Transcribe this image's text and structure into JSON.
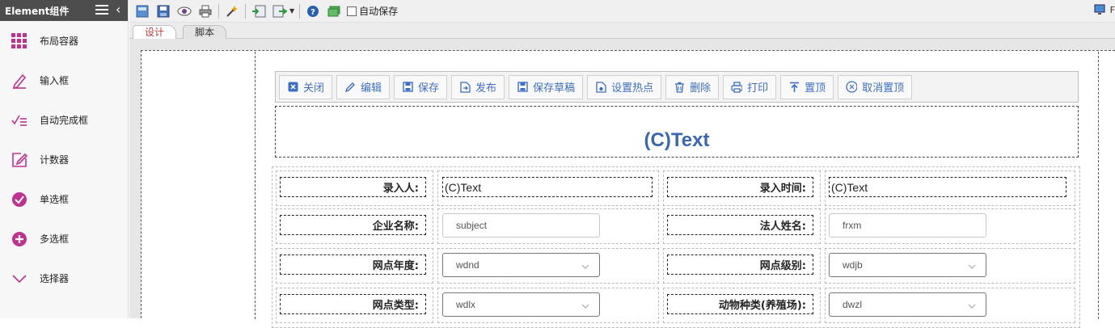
{
  "sidebar": {
    "title": "Element组件",
    "items": [
      {
        "label": "布局容器",
        "icon": "grid-icon"
      },
      {
        "label": "输入框",
        "icon": "pen-input-icon"
      },
      {
        "label": "自动完成框",
        "icon": "autocomplete-icon"
      },
      {
        "label": "计数器",
        "icon": "edit-box-icon"
      },
      {
        "label": "单选框",
        "icon": "check-circle-icon"
      },
      {
        "label": "多选框",
        "icon": "plus-circle-icon"
      },
      {
        "label": "选择器",
        "icon": "chevron-down-icon"
      }
    ]
  },
  "toolbar": {
    "buttons": [
      "new-icon",
      "save-icon",
      "preview-icon",
      "print-icon",
      "wand-icon",
      "import-icon",
      "export-icon",
      "help-icon",
      "window-icon"
    ],
    "autosave_label": "自动保存",
    "right_cut_text": "F"
  },
  "tabs": [
    {
      "label": "设计",
      "active": true
    },
    {
      "label": "脚本",
      "active": false
    }
  ],
  "actions": [
    {
      "label": "关闭",
      "icon": "close-box-icon"
    },
    {
      "label": "编辑",
      "icon": "pencil-icon"
    },
    {
      "label": "保存",
      "icon": "floppy-icon"
    },
    {
      "label": "发布",
      "icon": "publish-icon"
    },
    {
      "label": "保存草稿",
      "icon": "floppy-icon"
    },
    {
      "label": "设置热点",
      "icon": "hotspot-icon"
    },
    {
      "label": "删除",
      "icon": "trash-icon"
    },
    {
      "label": "打印",
      "icon": "printer-icon"
    },
    {
      "label": "置顶",
      "icon": "pin-top-icon"
    },
    {
      "label": "取消置顶",
      "icon": "unpin-icon"
    }
  ],
  "form_title": "(C)Text",
  "rows": [
    {
      "l1": "录入人:",
      "v1": "(C)Text",
      "t1": "text",
      "l2": "录入时间:",
      "v2": "(C)Text",
      "t2": "text"
    },
    {
      "l1": "企业名称:",
      "v1": "subject",
      "t1": "input",
      "l2": "法人姓名:",
      "v2": "frxm",
      "t2": "input"
    },
    {
      "l1": "网点年度:",
      "v1": "wdnd",
      "t1": "select",
      "l2": "网点级别:",
      "v2": "wdjb",
      "t2": "select"
    },
    {
      "l1": "网点类型:",
      "v1": "wdlx",
      "t1": "select",
      "l2": "动物种类(养殖场):",
      "v2": "dwzl",
      "t2": "select"
    }
  ],
  "colors": {
    "accent": "#3d6fc4",
    "brand_magenta": "#c0328f",
    "title_blue": "#3b67b0",
    "sidebar_header": "#4d4d4d"
  }
}
